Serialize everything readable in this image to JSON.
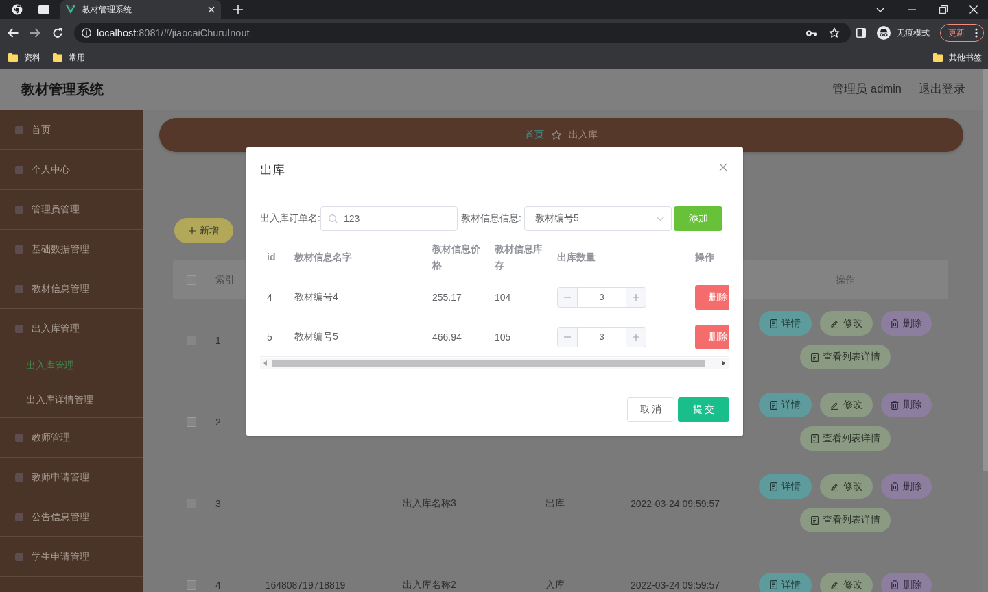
{
  "browser": {
    "tab_title": "教材管理系统",
    "url_host": "localhost",
    "url_rest": ":8081/#/jiaocaiChuruInout",
    "profile_label": "无痕模式",
    "update_label": "更新",
    "bookmarks": [
      {
        "label": "资料"
      },
      {
        "label": "常用"
      }
    ],
    "other_bookmarks": "其他书签"
  },
  "header": {
    "title": "教材管理系统",
    "user": "管理员 admin",
    "logout": "退出登录"
  },
  "sidebar": {
    "items": [
      {
        "label": "首页"
      },
      {
        "label": "个人中心"
      },
      {
        "label": "管理员管理"
      },
      {
        "label": "基础数据管理"
      },
      {
        "label": "教材信息管理"
      },
      {
        "label": "出入库管理",
        "expanded": true,
        "children": [
          {
            "label": "出入库管理",
            "selected": true
          },
          {
            "label": "出入库详情管理",
            "selected": false
          }
        ]
      },
      {
        "label": "教师管理"
      },
      {
        "label": "教师申请管理"
      },
      {
        "label": "公告信息管理"
      },
      {
        "label": "学生申请管理"
      }
    ]
  },
  "breadcrumb": [
    {
      "label": "首页"
    },
    {
      "label": "出入库"
    }
  ],
  "toolbar": {
    "buttons": [
      {
        "label": "新增",
        "kind": "add"
      }
    ]
  },
  "table": {
    "all_checked": false,
    "index_heading": "索引",
    "actions_heading": "操作",
    "rows": [
      {
        "index": "1",
        "checked": false,
        "actions": [
          {
            "label": "详情",
            "kind": "detail"
          },
          {
            "label": "修改",
            "kind": "edit"
          },
          {
            "label": "删除",
            "kind": "delete"
          },
          {
            "label": "查看列表详情",
            "kind": "list"
          }
        ]
      },
      {
        "index": "2",
        "checked": false,
        "actions": [
          {
            "label": "详情",
            "kind": "detail"
          },
          {
            "label": "修改",
            "kind": "edit"
          },
          {
            "label": "删除",
            "kind": "delete"
          },
          {
            "label": "查看列表详情",
            "kind": "list"
          }
        ]
      },
      {
        "index": "3",
        "checked": false,
        "column_4": "出入库名称3",
        "column_5": "出库",
        "column_6": "2022-03-24 09:59:57",
        "actions": [
          {
            "label": "详情",
            "kind": "detail"
          },
          {
            "label": "修改",
            "kind": "edit"
          },
          {
            "label": "删除",
            "kind": "delete"
          },
          {
            "label": "查看列表详情",
            "kind": "list"
          }
        ]
      },
      {
        "index": "4",
        "checked": false,
        "column_3": "164808719718819",
        "column_4": "出入库名称2",
        "column_5": "入库",
        "column_6": "2022-03-24 09:59:57",
        "actions": [
          {
            "label": "详情",
            "kind": "detail"
          },
          {
            "label": "修改",
            "kind": "edit"
          },
          {
            "label": "删除",
            "kind": "delete"
          }
        ]
      }
    ]
  },
  "dialog": {
    "title": "出库",
    "order_label": "出入库订单名:",
    "order_value": "123",
    "material_label": "教材信息信息:",
    "material_value": "教材编号5",
    "add_button": "添加",
    "columns": [
      {
        "label": "id"
      },
      {
        "label": "教材信息名字"
      },
      {
        "label": "教材信息价格"
      },
      {
        "label": "教材信息库存"
      },
      {
        "label": "出库数量"
      },
      {
        "label": "操作"
      }
    ],
    "rows": [
      {
        "id": "4",
        "name": "教材编号4",
        "price": "255.17",
        "stock": "104",
        "quantity": "3",
        "action": "删除"
      },
      {
        "id": "5",
        "name": "教材编号5",
        "price": "466.94",
        "stock": "105",
        "quantity": "3",
        "action": "删除"
      }
    ],
    "cancel_button": "取 消",
    "submit_button": "提 交"
  }
}
